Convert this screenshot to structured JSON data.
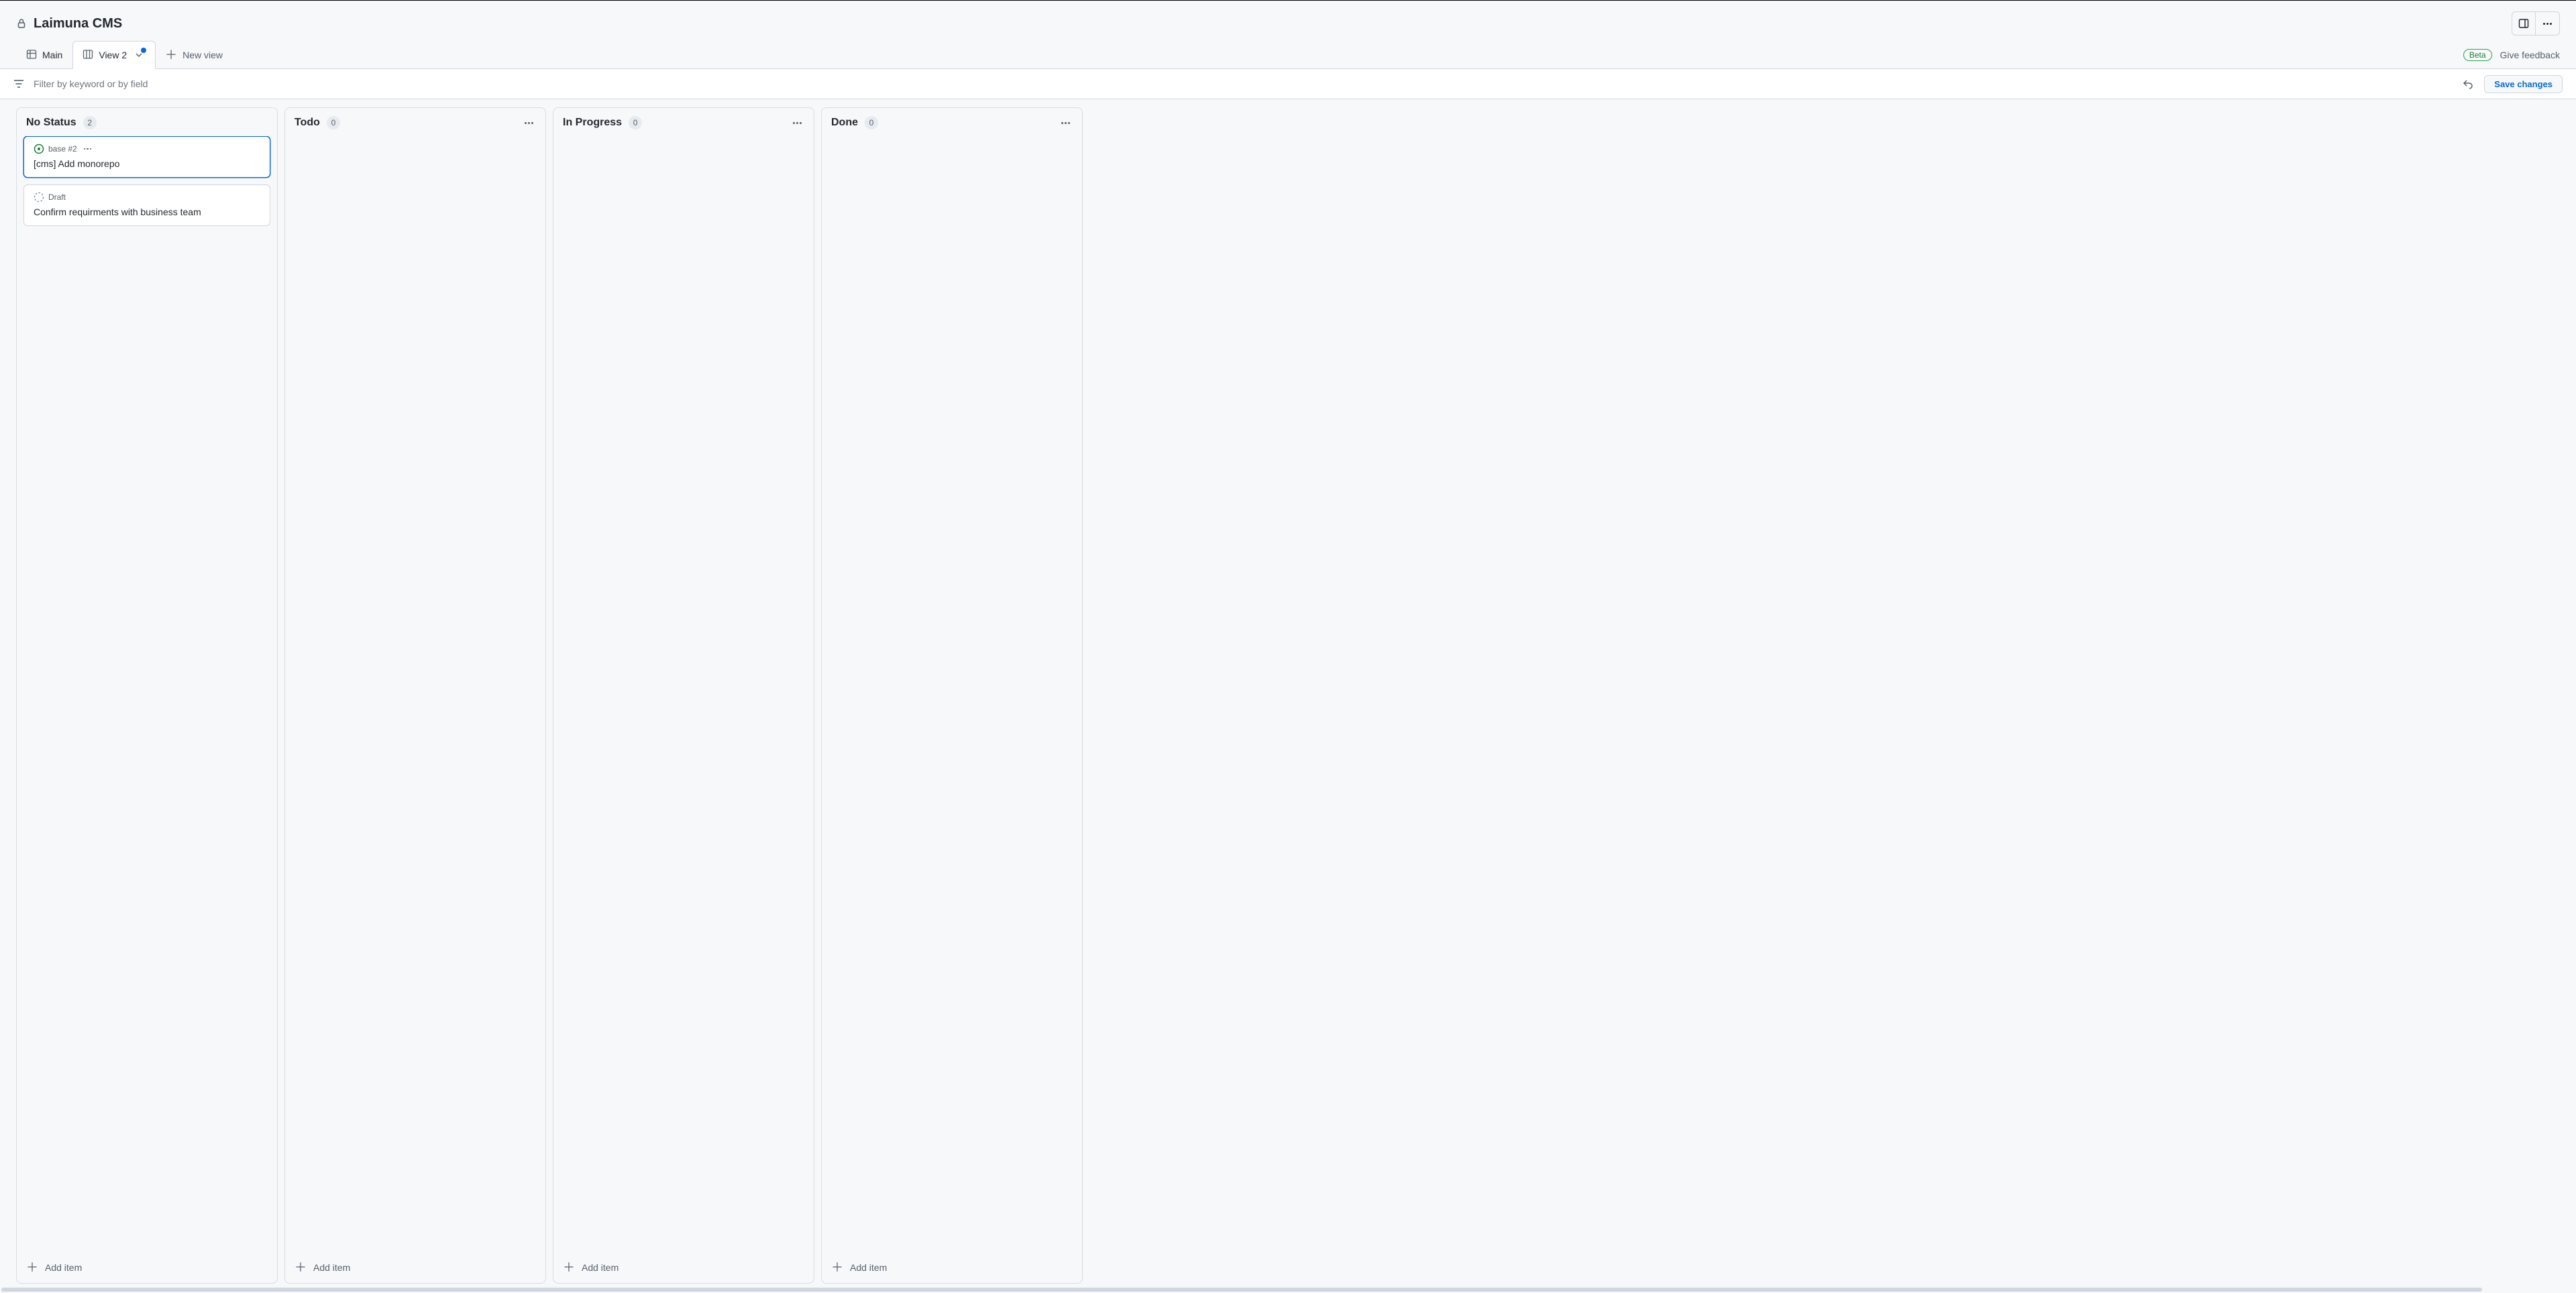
{
  "header": {
    "title": "Laimuna CMS"
  },
  "tabs": {
    "main": "Main",
    "view2": "View 2",
    "newView": "New view"
  },
  "topright": {
    "beta": "Beta",
    "feedback": "Give feedback"
  },
  "filter": {
    "placeholder": "Filter by keyword or by field",
    "save": "Save changes"
  },
  "board": {
    "addItem": "Add item",
    "columns": [
      {
        "title": "No Status",
        "count": "2",
        "showMenu": false,
        "cards": [
          {
            "type": "issue",
            "meta": "base #2",
            "title": "[cms] Add monorepo",
            "selected": true,
            "showMenu": true
          },
          {
            "type": "draft",
            "meta": "Draft",
            "title": "Confirm requirments with business team",
            "selected": false,
            "showMenu": false
          }
        ]
      },
      {
        "title": "Todo",
        "count": "0",
        "showMenu": true,
        "cards": []
      },
      {
        "title": "In Progress",
        "count": "0",
        "showMenu": true,
        "cards": []
      },
      {
        "title": "Done",
        "count": "0",
        "showMenu": true,
        "cards": []
      }
    ]
  }
}
